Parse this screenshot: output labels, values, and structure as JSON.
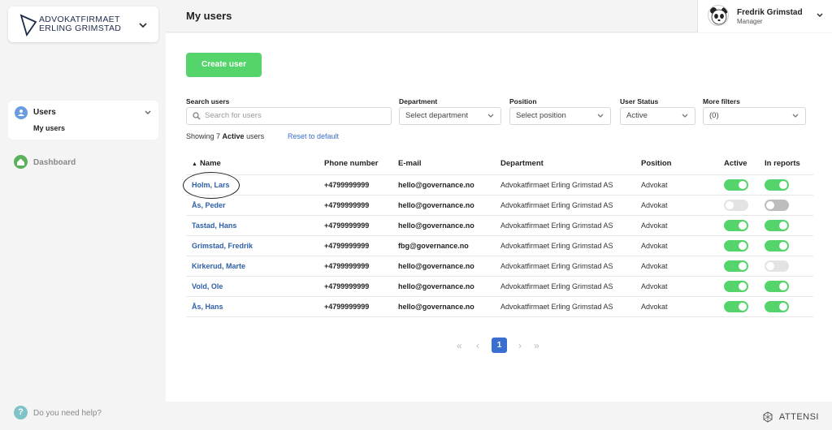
{
  "org": {
    "line1": "ADVOKATFIRMAET",
    "line2": "ERLING GRIMSTAD",
    "chevron_icon": "chevron-down-icon"
  },
  "sidebar": {
    "users_label": "Users",
    "my_users_label": "My users",
    "dashboard_label": "Dashboard",
    "help_label": "Do you need help?",
    "help_glyph": "?"
  },
  "header": {
    "title": "My users",
    "user_name": "Fredrik Grimstad",
    "user_role": "Manager"
  },
  "main": {
    "create_button": "Create user",
    "filters": {
      "search_label": "Search users",
      "search_placeholder": "Search for users",
      "department_label": "Department",
      "department_value": "Select department",
      "position_label": "Position",
      "position_value": "Select position",
      "status_label": "User Status",
      "status_value": "Active",
      "more_label": "More filters",
      "more_value": "(0)"
    },
    "showing_prefix": "Showing 7",
    "showing_bold": "Active",
    "showing_suffix": "users",
    "reset_label": "Reset to default"
  },
  "table": {
    "columns": {
      "name": "Name",
      "phone": "Phone number",
      "email": "E-mail",
      "department": "Department",
      "position": "Position",
      "active": "Active",
      "reports": "In reports"
    },
    "rows": [
      {
        "name": "Holm, Lars",
        "phone": "+4799999999",
        "email": "hello@governance.no",
        "department": "Advokatfirmaet Erling Grimstad AS",
        "position": "Advokat",
        "active": true,
        "reports": true
      },
      {
        "name": "Ås, Peder",
        "phone": "+4799999999",
        "email": "hello@governance.no",
        "department": "Advokatfirmaet Erling Grimstad AS",
        "position": "Advokat",
        "active": false,
        "reports": false
      },
      {
        "name": "Tastad, Hans",
        "phone": "+4799999999",
        "email": "hello@governance.no",
        "department": "Advokatfirmaet Erling Grimstad AS",
        "position": "Advokat",
        "active": true,
        "reports": true
      },
      {
        "name": "Grimstad, Fredrik",
        "phone": "+4799999999",
        "email": "fbg@governance.no",
        "department": "Advokatfirmaet Erling Grimstad AS",
        "position": "Advokat",
        "active": true,
        "reports": true
      },
      {
        "name": "Kirkerud, Marte",
        "phone": "+4799999999",
        "email": "hello@governance.no",
        "department": "Advokatfirmaet Erling Grimstad AS",
        "position": "Advokat",
        "active": true,
        "reports": false
      },
      {
        "name": "Vold, Ole",
        "phone": "+4799999999",
        "email": "hello@governance.no",
        "department": "Advokatfirmaet Erling Grimstad AS",
        "position": "Advokat",
        "active": true,
        "reports": true
      },
      {
        "name": "Ås, Hans",
        "phone": "+4799999999",
        "email": "hello@governance.no",
        "department": "Advokatfirmaet Erling Grimstad AS",
        "position": "Advokat",
        "active": true,
        "reports": true
      }
    ]
  },
  "pagination": {
    "first": "«",
    "prev": "‹",
    "current": "1",
    "next": "›",
    "last": "»"
  },
  "footer": {
    "brand": "ATTENSI"
  },
  "colors": {
    "accent_green": "#54d46a",
    "link_blue": "#3a6fd1",
    "name_blue": "#2e5fa8"
  }
}
